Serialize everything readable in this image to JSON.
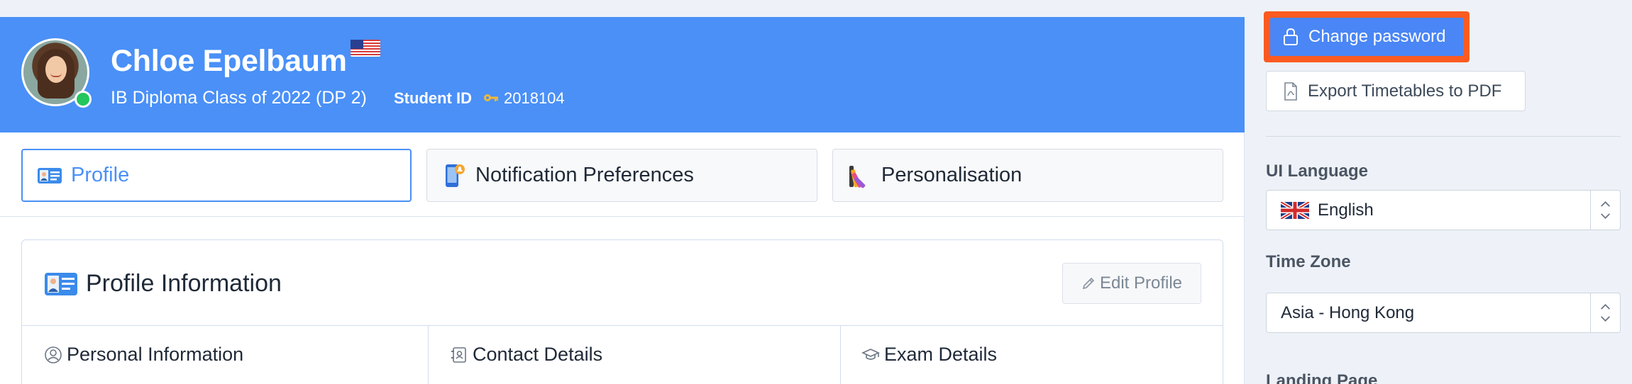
{
  "header": {
    "student_name": "Chloe Epelbaum",
    "class_line": "IB Diploma Class of 2022 (DP 2)",
    "student_id_label": "Student ID",
    "student_id_value": "2018104",
    "status": "online"
  },
  "tabs": [
    {
      "label": "Profile",
      "icon": "profile-card-icon",
      "active": true
    },
    {
      "label": "Notification Preferences",
      "icon": "phone-bell-icon",
      "active": false
    },
    {
      "label": "Personalisation",
      "icon": "paint-palette-icon",
      "active": false
    }
  ],
  "profile_card": {
    "title": "Profile Information",
    "edit_label": "Edit Profile",
    "sections": [
      {
        "label": "Personal Information",
        "icon": "user-circle-icon"
      },
      {
        "label": "Contact Details",
        "icon": "address-book-icon"
      },
      {
        "label": "Exam Details",
        "icon": "graduation-cap-icon"
      }
    ]
  },
  "sidebar": {
    "change_password_label": "Change password",
    "export_label": "Export Timetables to PDF",
    "ui_language_label": "UI Language",
    "ui_language_value": "English",
    "time_zone_label": "Time Zone",
    "time_zone_value": "Asia - Hong Kong",
    "landing_page_label": "Landing Page"
  },
  "colors": {
    "accent": "#4a90f7",
    "highlight": "#fb5b21",
    "online": "#22c55e"
  }
}
